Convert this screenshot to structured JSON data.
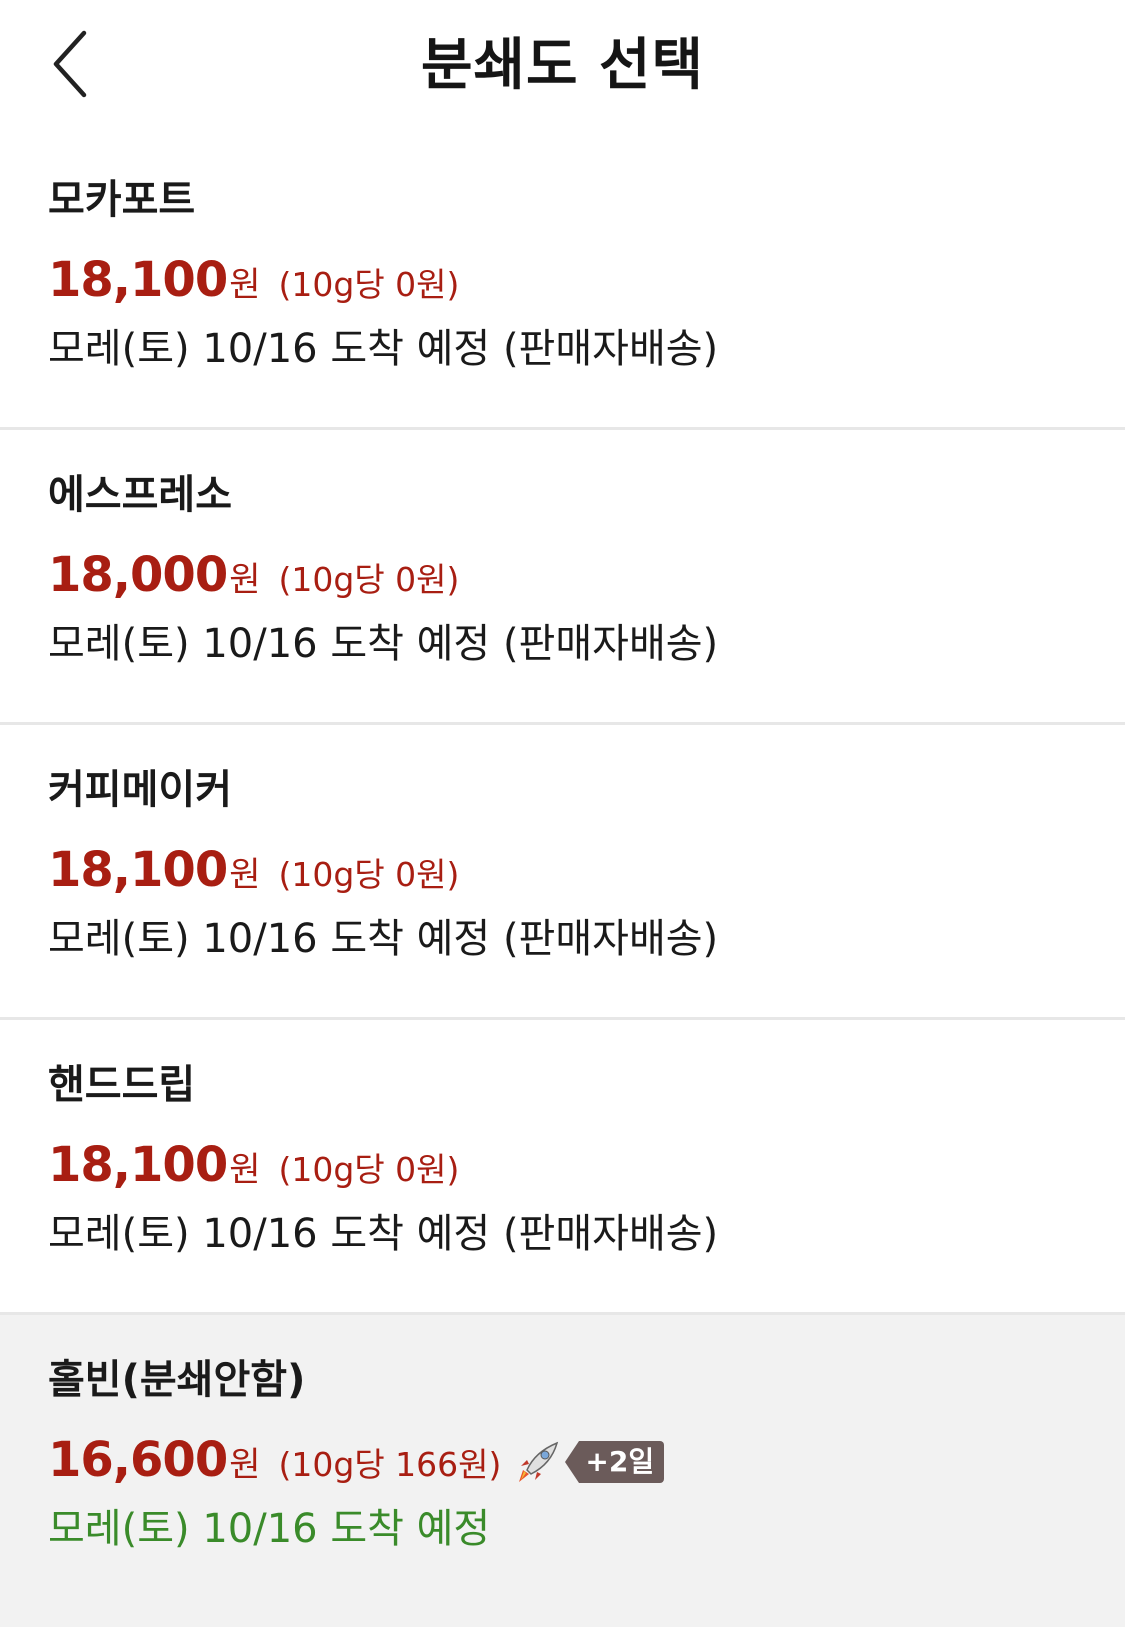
{
  "header": {
    "title": "분쇄도 선택",
    "back_icon": "chevron-left-icon"
  },
  "colors": {
    "price": "#a81e12",
    "delivery_rocket": "#3a8b2a",
    "badge": "#6b5b5a",
    "divider": "#e7e7e7",
    "selected_bg": "#f2f2f2"
  },
  "options": [
    {
      "name": "모카포트",
      "price": "18,100",
      "price_unit": "원",
      "unit_price": "(10g당 0원)",
      "delivery": "모레(토) 10/16 도착 예정 (판매자배송)"
    },
    {
      "name": "에스프레소",
      "price": "18,000",
      "price_unit": "원",
      "unit_price": "(10g당 0원)",
      "delivery": "모레(토) 10/16 도착 예정 (판매자배송)"
    },
    {
      "name": "커피메이커",
      "price": "18,100",
      "price_unit": "원",
      "unit_price": "(10g당 0원)",
      "delivery": "모레(토) 10/16 도착 예정 (판매자배송)"
    },
    {
      "name": "핸드드립",
      "price": "18,100",
      "price_unit": "원",
      "unit_price": "(10g당 0원)",
      "delivery": "모레(토) 10/16 도착 예정 (판매자배송)"
    },
    {
      "name": "홀빈(분쇄안함)",
      "price": "16,600",
      "price_unit": "원",
      "unit_price": "(10g당 166원)",
      "badge": "+2일",
      "badge_icon": "rocket-icon",
      "delivery": "모레(토) 10/16 도착 예정"
    }
  ]
}
